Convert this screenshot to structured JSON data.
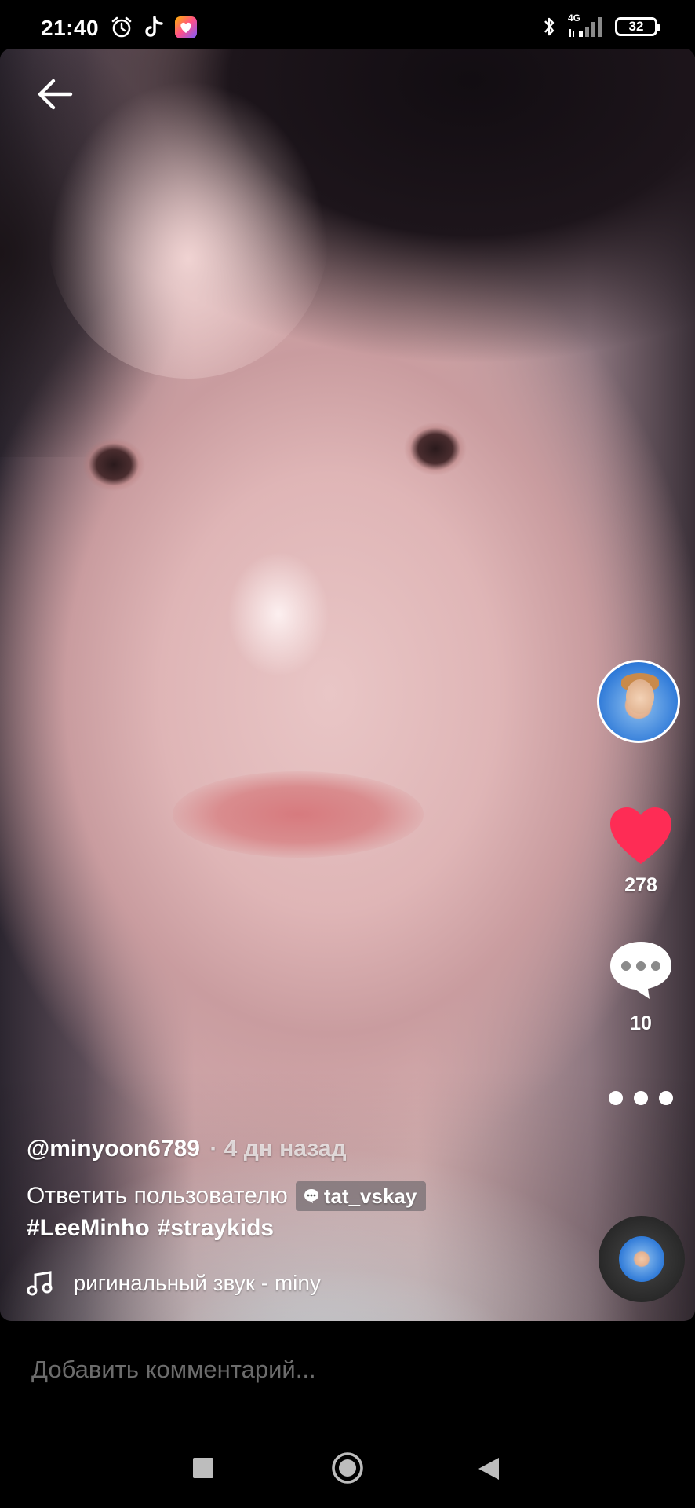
{
  "status_bar": {
    "time": "21:40",
    "network": "4G",
    "battery": "32",
    "icons": [
      "alarm-icon",
      "tiktok-icon",
      "gallery-app-icon",
      "bluetooth-icon",
      "signal-icon",
      "battery-icon"
    ]
  },
  "video": {
    "back_icon": "arrow-left-icon"
  },
  "rail": {
    "avatar_icon": "avatar",
    "like_count": "278",
    "like_color": "#fe2c55",
    "comment_count": "10",
    "more_icon": "more-dots-icon"
  },
  "caption": {
    "author": "@minyoon6789",
    "meta": "· 4 дн назад",
    "reply_text": "Ответить пользователю",
    "mention": "tat_vskay",
    "hashtags": [
      "#LeeMinho",
      "#straykids"
    ],
    "music": "оригинальный звук - miny"
  },
  "comment_bar": {
    "placeholder": "Добавить комментарий..."
  },
  "nav": {
    "recents_icon": "square-icon",
    "home_icon": "circle-icon",
    "back_icon": "triangle-back-icon"
  }
}
